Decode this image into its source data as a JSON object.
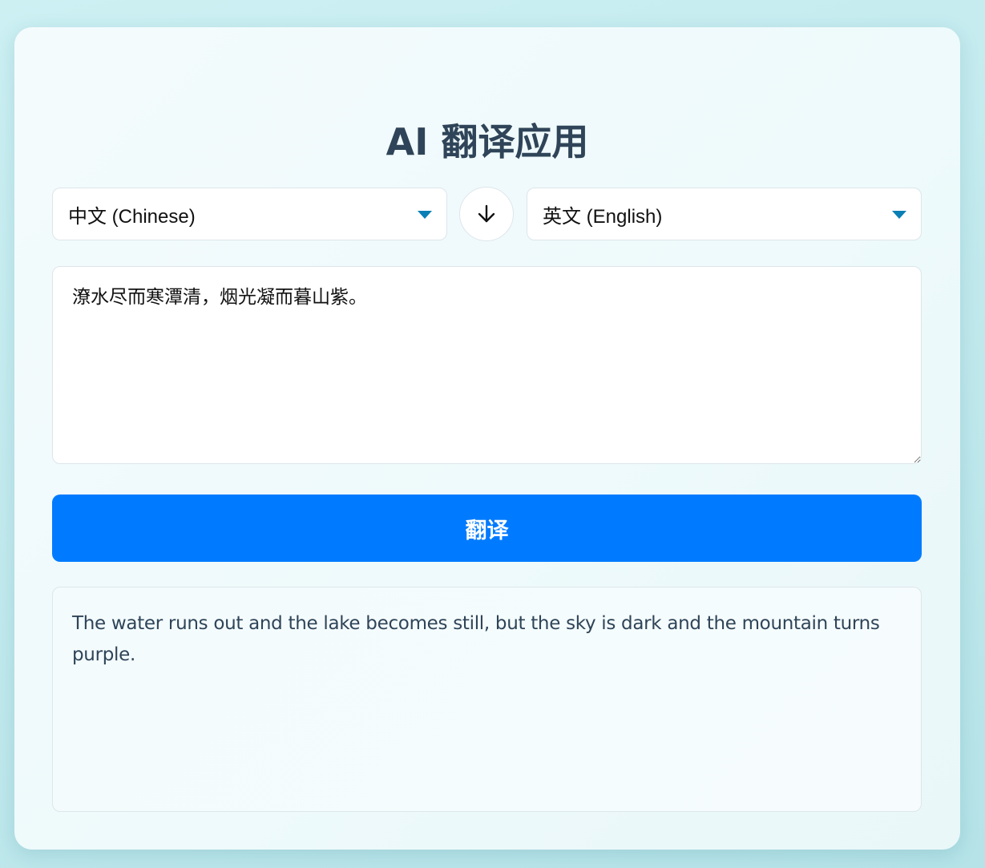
{
  "app": {
    "title": "AI 翻译应用"
  },
  "languages": {
    "source": "中文 (Chinese)",
    "target": "英文 (English)",
    "swap_icon": "arrow-down-icon"
  },
  "input": {
    "value": "潦水尽而寒潭清，烟光凝而暮山紫。"
  },
  "actions": {
    "translate_label": "翻译"
  },
  "output": {
    "text": "The water runs out and the lake becomes still, but the sky is dark and the mountain turns purple."
  },
  "colors": {
    "accent": "#007bff",
    "caret": "#0a7fb5",
    "title": "#2f4458"
  }
}
